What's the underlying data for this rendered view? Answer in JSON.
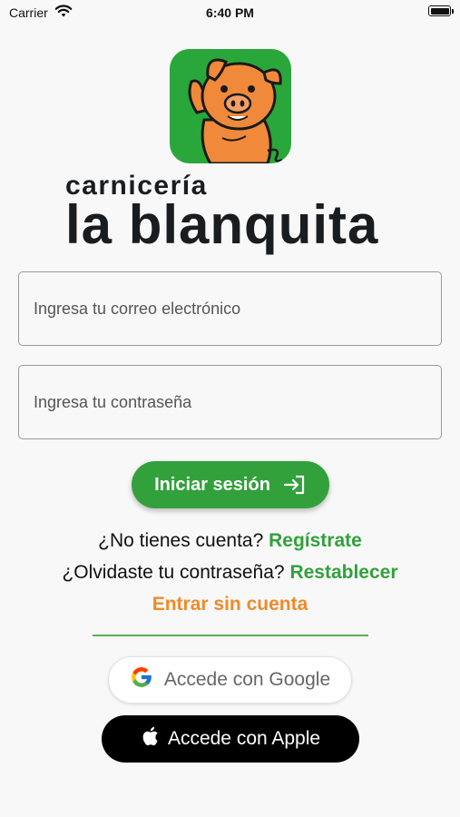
{
  "status_bar": {
    "carrier": "Carrier",
    "time": "6:40 PM"
  },
  "brand": {
    "line1": "carnicería",
    "line2": "la blanquita",
    "logo_icon": "pig-mascot-icon",
    "colors": {
      "tile": "#2aa73a",
      "pig": "#f08a3a",
      "text": "#1a1d20"
    }
  },
  "form": {
    "email_placeholder": "Ingresa tu correo electrónico",
    "password_placeholder": "Ingresa tu contraseña",
    "login_label": "Iniciar sesión",
    "login_icon": "login-arrow-icon"
  },
  "links": {
    "no_account_text": "¿No tienes cuenta?",
    "register_label": "Regístrate",
    "forgot_text": "¿Olvidaste tu contraseña?",
    "reset_label": "Restablecer",
    "guest_label": "Entrar sin cuenta"
  },
  "social": {
    "google_label": "Accede con Google",
    "google_icon": "google-icon",
    "apple_label": "Accede con Apple",
    "apple_icon": "apple-icon"
  },
  "colors": {
    "primary_green": "#32a13c",
    "accent_orange": "#ee8a2a",
    "background": "#f8f8f8"
  }
}
